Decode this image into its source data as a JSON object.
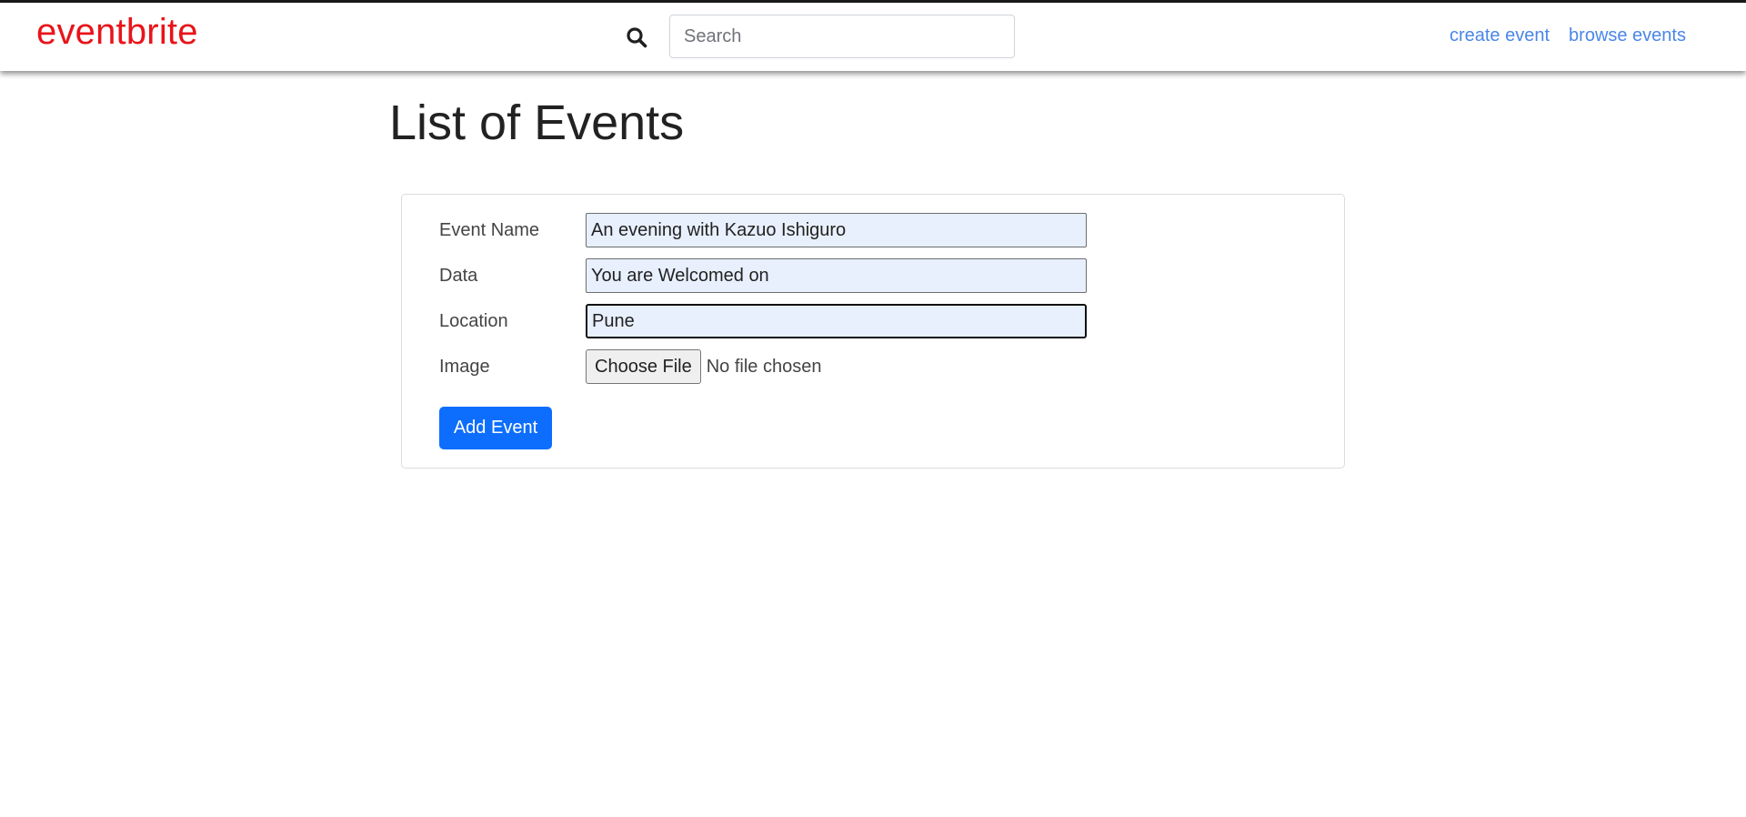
{
  "navbar": {
    "brand": "eventbrite",
    "search_placeholder": "Search",
    "links": [
      "create event",
      "browse events"
    ]
  },
  "page": {
    "title": "List of Events"
  },
  "form": {
    "event_name": {
      "label": "Event Name",
      "value": "An evening with Kazuo Ishiguro"
    },
    "data": {
      "label": "Data",
      "value": "You are Welcomed on"
    },
    "location": {
      "label": "Location",
      "value": "Pune"
    },
    "image": {
      "label": "Image",
      "button": "Choose File",
      "status": "No file chosen"
    },
    "submit": "Add Event"
  },
  "colors": {
    "brand": "#e8141a",
    "link": "#4a86e8",
    "primary_button": "#0d6efd",
    "autofill_field": "#e8f0fe"
  },
  "icons": {
    "search": "magnifying-glass"
  }
}
